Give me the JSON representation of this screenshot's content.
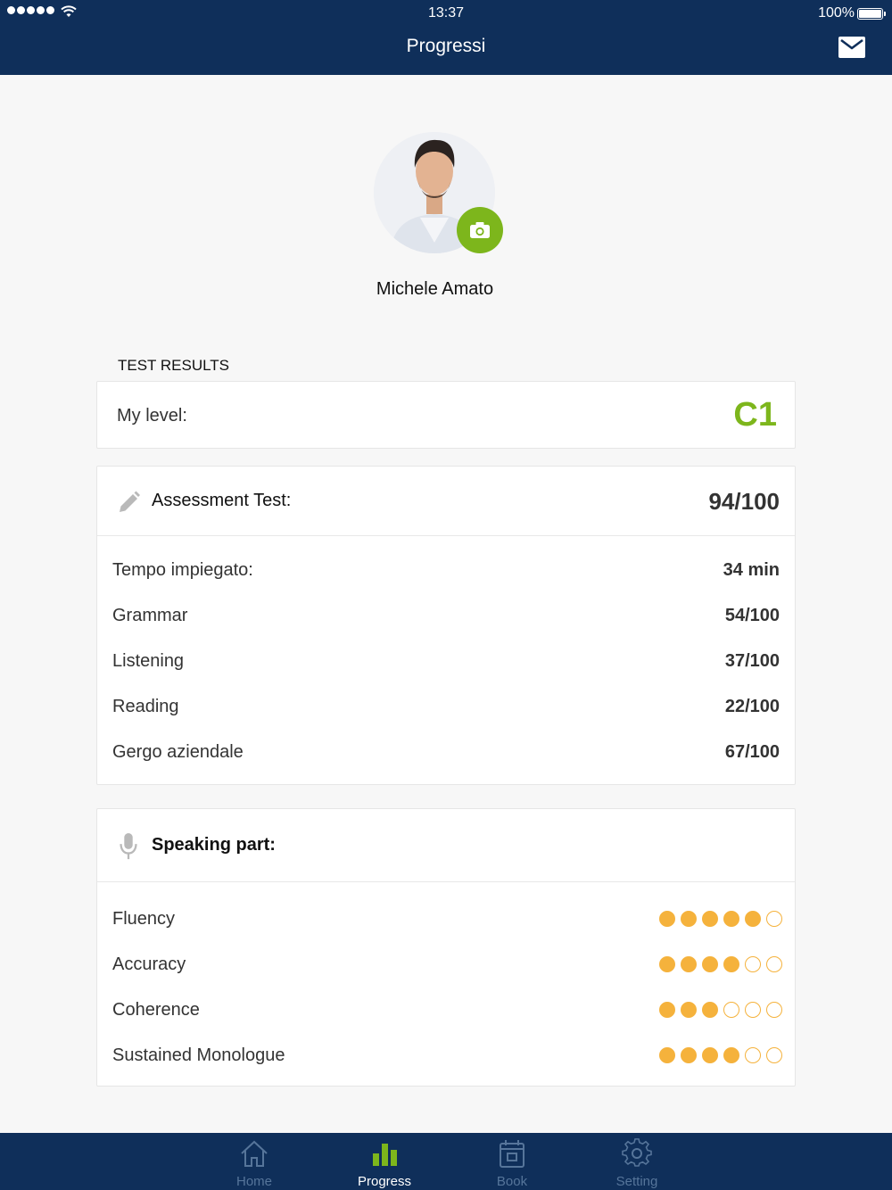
{
  "status_bar": {
    "time": "13:37",
    "battery": "100%"
  },
  "header": {
    "title": "Progressi"
  },
  "profile": {
    "name": "Michele Amato"
  },
  "test_results": {
    "section_title": "TEST RESULTS",
    "level_label": "My level:",
    "level_value": "C1"
  },
  "assessment": {
    "title": "Assessment Test:",
    "score": "94/100",
    "rows": [
      {
        "label": "Tempo impiegato:",
        "value": "34 min"
      },
      {
        "label": "Grammar",
        "value": "54/100"
      },
      {
        "label": "Listening",
        "value": "37/100"
      },
      {
        "label": "Reading",
        "value": "22/100"
      },
      {
        "label": "Gergo aziendale",
        "value": "67/100"
      }
    ]
  },
  "speaking": {
    "title": "Speaking part:",
    "max_rating": 6,
    "rows": [
      {
        "label": "Fluency",
        "rating": 5
      },
      {
        "label": "Accuracy",
        "rating": 4
      },
      {
        "label": "Coherence",
        "rating": 3
      },
      {
        "label": "Sustained Monologue",
        "rating": 4
      }
    ]
  },
  "tabbar": {
    "items": [
      {
        "label": "Home",
        "icon": "home-icon"
      },
      {
        "label": "Progress",
        "icon": "bar-chart-icon"
      },
      {
        "label": "Book",
        "icon": "calendar-icon"
      },
      {
        "label": "Setting",
        "icon": "gear-icon"
      }
    ],
    "active": "Progress"
  },
  "colors": {
    "navy": "#0f2f5a",
    "accent_green": "#7db61c",
    "rating_orange": "#f5b23c",
    "inactive_tab": "#56759a"
  }
}
